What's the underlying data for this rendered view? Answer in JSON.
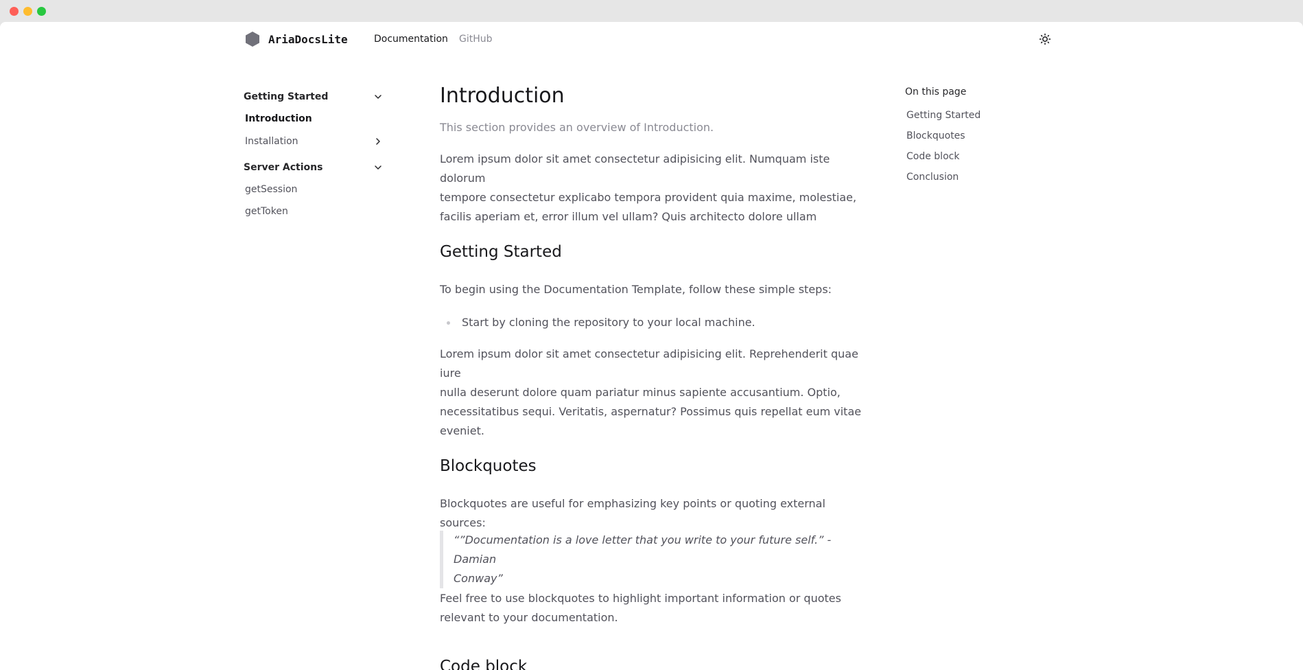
{
  "window": {
    "traffic_lights": [
      "close",
      "minimize",
      "zoom"
    ]
  },
  "header": {
    "brand": "AriaDocsLite",
    "nav": [
      {
        "label": "Documentation"
      },
      {
        "label": "GitHub"
      }
    ],
    "theme_toggle_icon": "sun-icon"
  },
  "sidebar": {
    "sections": [
      {
        "title": "Getting Started",
        "items": [
          {
            "label": "Introduction"
          },
          {
            "label": "Installation"
          }
        ]
      },
      {
        "title": "Server Actions",
        "items": [
          {
            "label": "getSession"
          },
          {
            "label": "getToken"
          }
        ]
      }
    ]
  },
  "main": {
    "title": "Introduction",
    "subtitle": "This section provides an overview of Introduction.",
    "intro_lines": [
      "Lorem ipsum dolor sit amet consectetur adipisicing elit. Numquam iste dolorum",
      "tempore consectetur explicabo tempora provident quia maxime, molestiae,",
      "facilis aperiam et, error illum vel ullam? Quis architecto dolore ullam"
    ],
    "getting_started": {
      "heading": "Getting Started",
      "lead": "To begin using the Documentation Template, follow these simple steps:",
      "bullets": [
        "Start by cloning the repository to your local machine."
      ],
      "body_lines": [
        "Lorem ipsum dolor sit amet consectetur adipisicing elit. Reprehenderit quae iure",
        "nulla deserunt dolore quam pariatur minus sapiente accusantium. Optio,",
        "necessitatibus sequi. Veritatis, aspernatur? Possimus quis repellat eum vitae",
        "eveniet."
      ]
    },
    "blockquotes": {
      "heading": "Blockquotes",
      "lead": "Blockquotes are useful for emphasizing key points or quoting external sources:",
      "quote_lines": [
        "“”Documentation is a love letter that you write to your future self.” - Damian",
        "Conway”"
      ],
      "after_lines": [
        "Feel free to use blockquotes to highlight important information or quotes",
        "relevant to your documentation."
      ]
    },
    "code_block": {
      "heading": "Code block"
    }
  },
  "toc": {
    "title": "On this page",
    "items": [
      {
        "label": "Getting Started"
      },
      {
        "label": "Blockquotes"
      },
      {
        "label": "Code block"
      },
      {
        "label": "Conclusion"
      }
    ]
  }
}
